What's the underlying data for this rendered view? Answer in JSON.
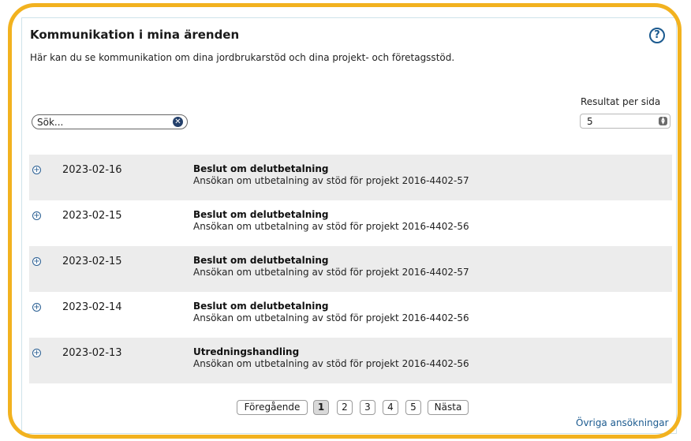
{
  "header": {
    "title": "Kommunikation i mina ärenden",
    "subtitle": "Här kan du se kommunikation om dina jordbrukarstöd och dina projekt- och företagsstöd.",
    "help_label": "?"
  },
  "search": {
    "placeholder": "Sök...",
    "value": ""
  },
  "results_per_page": {
    "label": "Resultat per sida",
    "value": "5"
  },
  "rows": [
    {
      "date": "2023-02-16",
      "title": "Beslut om delutbetalning",
      "description": "Ansökan om utbetalning av stöd för projekt 2016-4402-57"
    },
    {
      "date": "2023-02-15",
      "title": "Beslut om delutbetalning",
      "description": "Ansökan om utbetalning av stöd för projekt 2016-4402-56"
    },
    {
      "date": "2023-02-15",
      "title": "Beslut om delutbetalning",
      "description": "Ansökan om utbetalning av stöd för projekt 2016-4402-57"
    },
    {
      "date": "2023-02-14",
      "title": "Beslut om delutbetalning",
      "description": "Ansökan om utbetalning av stöd för projekt 2016-4402-56"
    },
    {
      "date": "2023-02-13",
      "title": "Utredningshandling",
      "description": "Ansökan om utbetalning av stöd för projekt 2016-4402-56"
    }
  ],
  "pagination": {
    "previous": "Föregående",
    "pages": [
      "1",
      "2",
      "3",
      "4",
      "5"
    ],
    "current": "1",
    "next": "Nästa"
  },
  "footer": {
    "other_applications": "Övriga ansökningar"
  },
  "colors": {
    "highlight": "#f2b21f",
    "link": "#1b5a8f",
    "row_shade": "#ececec"
  }
}
